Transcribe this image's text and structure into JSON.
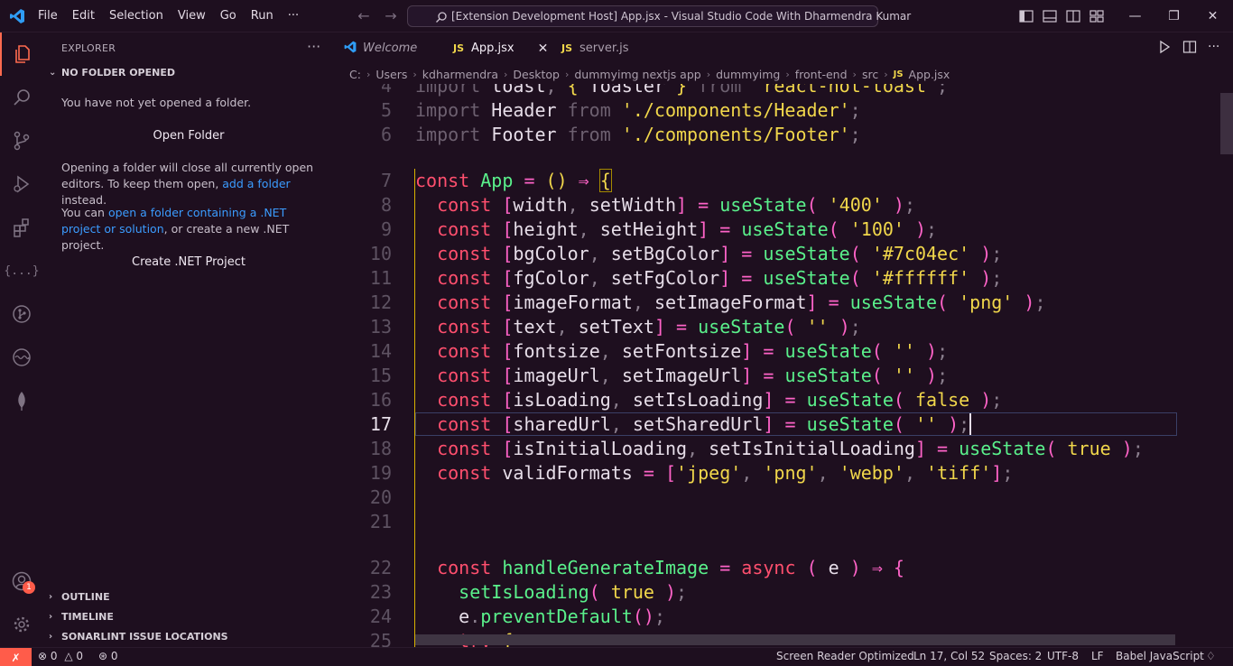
{
  "titlebar": {
    "menus": [
      "File",
      "Edit",
      "Selection",
      "View",
      "Go",
      "Run",
      "···"
    ],
    "window_title": "[Extension Development Host] App.jsx - Visual Studio Code With Dharmendra Kumar"
  },
  "sidebar": {
    "title": "EXPLORER",
    "section_title": "NO FOLDER OPENED",
    "message": "You have not yet opened a folder.",
    "open_folder_button": "Open Folder",
    "warning_part1": "Opening a folder will close all currently open editors. To keep them open, ",
    "warning_link": "add a folder",
    "warning_part2": " instead.",
    "net_part1": "You can ",
    "net_link": "open a folder containing a .NET project or solution",
    "net_part2": ", or create a new .NET project.",
    "create_net_button": "Create .NET Project",
    "outline_label": "OUTLINE",
    "timeline_label": "TIMELINE",
    "sonarlint_label": "SONARLINT ISSUE LOCATIONS",
    "accounts_badge": "1"
  },
  "tabs": [
    {
      "label": "Welcome",
      "kind": "vscode"
    },
    {
      "label": "App.jsx",
      "kind": "js",
      "active": true
    },
    {
      "label": "server.js",
      "kind": "js"
    }
  ],
  "breadcrumb": [
    "C:",
    "Users",
    "kdharmendra",
    "Desktop",
    "dummyimg nextjs app",
    "dummyimg",
    "front-end",
    "src",
    "App.jsx"
  ],
  "editor": {
    "line_numbers": [
      "4",
      "5",
      "6",
      "7",
      "8",
      "9",
      "10",
      "11",
      "12",
      "13",
      "14",
      "15",
      "16",
      "17",
      "18",
      "19",
      "20",
      "21",
      "22",
      "23",
      "24",
      "25"
    ],
    "current_line": "17"
  },
  "status": {
    "problems_errors": "0",
    "problems_warnings": "0",
    "ports": "0",
    "screen_reader": "Screen Reader Optimized",
    "cursor_position": "Ln 17, Col 52",
    "indentation": "Spaces: 2",
    "encoding": "UTF-8",
    "eol": "LF",
    "language": "Babel JavaScript"
  },
  "colors": {
    "background": "#1e0f1f",
    "accent": "#ff5c4a",
    "keyword": "#ff4f6e",
    "function": "#5af08b",
    "string": "#f1d74b",
    "link": "#3b9cff"
  }
}
